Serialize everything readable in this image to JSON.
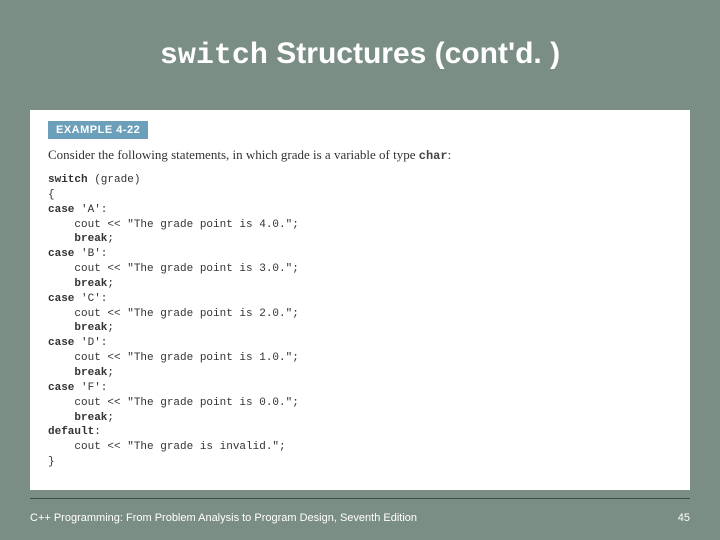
{
  "title": {
    "mono_part": "switch",
    "rest": " Structures (cont'd. )"
  },
  "example_badge": "EXAMPLE 4-22",
  "intro": {
    "prefix": "Consider the following statements, in which grade is a variable of type ",
    "type_word": "char",
    "suffix": ":"
  },
  "code_lines": [
    {
      "t": "kw",
      "v": "switch"
    },
    {
      "t": "plain",
      "v": " (grade)\n{\n"
    },
    {
      "t": "kw",
      "v": "case"
    },
    {
      "t": "plain",
      "v": " 'A':\n    cout << \"The grade point is 4.0.\";\n    "
    },
    {
      "t": "kw",
      "v": "break"
    },
    {
      "t": "plain",
      "v": ";\n"
    },
    {
      "t": "kw",
      "v": "case"
    },
    {
      "t": "plain",
      "v": " 'B':\n    cout << \"The grade point is 3.0.\";\n    "
    },
    {
      "t": "kw",
      "v": "break"
    },
    {
      "t": "plain",
      "v": ";\n"
    },
    {
      "t": "kw",
      "v": "case"
    },
    {
      "t": "plain",
      "v": " 'C':\n    cout << \"The grade point is 2.0.\";\n    "
    },
    {
      "t": "kw",
      "v": "break"
    },
    {
      "t": "plain",
      "v": ";\n"
    },
    {
      "t": "kw",
      "v": "case"
    },
    {
      "t": "plain",
      "v": " 'D':\n    cout << \"The grade point is 1.0.\";\n    "
    },
    {
      "t": "kw",
      "v": "break"
    },
    {
      "t": "plain",
      "v": ";\n"
    },
    {
      "t": "kw",
      "v": "case"
    },
    {
      "t": "plain",
      "v": " 'F':\n    cout << \"The grade point is 0.0.\";\n    "
    },
    {
      "t": "kw",
      "v": "break"
    },
    {
      "t": "plain",
      "v": ";\n"
    },
    {
      "t": "kw",
      "v": "default"
    },
    {
      "t": "plain",
      "v": ":\n    cout << \"The grade is invalid.\";\n}"
    }
  ],
  "footer": {
    "text": "C++ Programming: From Problem Analysis to Program Design, Seventh Edition",
    "page": "45"
  }
}
